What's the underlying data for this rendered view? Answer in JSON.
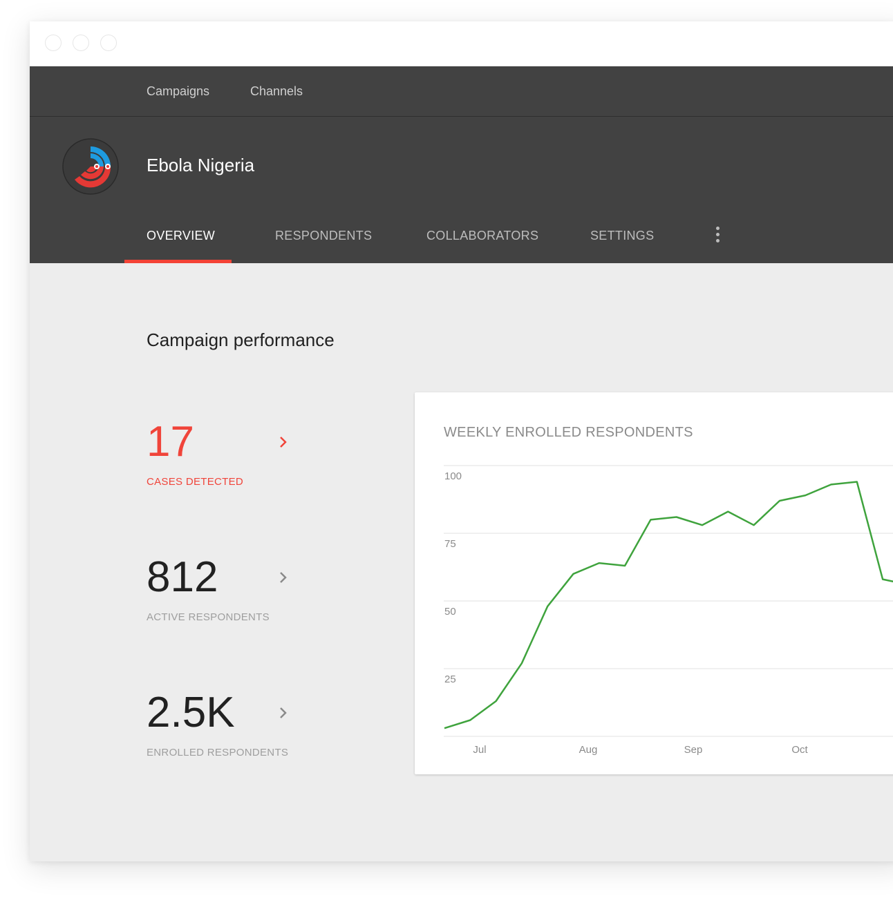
{
  "window": {
    "traffic_lights": [
      "close",
      "minimize",
      "maximize"
    ]
  },
  "topnav": {
    "items": [
      {
        "label": "Campaigns"
      },
      {
        "label": "Channels"
      }
    ]
  },
  "header": {
    "title": "Ebola Nigeria",
    "logo": "campaign-logo-icon",
    "tabs": [
      {
        "label": "OVERVIEW",
        "active": true
      },
      {
        "label": "RESPONDENTS",
        "active": false
      },
      {
        "label": "COLLABORATORS",
        "active": false
      },
      {
        "label": "SETTINGS",
        "active": false
      }
    ],
    "more_icon": "more-vert-icon",
    "accent_color": "#f44336",
    "background_color": "#424242"
  },
  "main": {
    "section_title": "Campaign performance",
    "stats": [
      {
        "value": "17",
        "label": "CASES DETECTED",
        "highlight": true
      },
      {
        "value": "812",
        "label": "ACTIVE RESPONDENTS",
        "highlight": false
      },
      {
        "value": "2.5K",
        "label": "ENROLLED RESPONDENTS",
        "highlight": false
      }
    ],
    "highlight_color": "#f0443a"
  },
  "chart_data": {
    "type": "line",
    "title": "WEEKLY ENROLLED RESPONDENTS",
    "xlabel": "",
    "ylabel": "",
    "ylim": [
      0,
      100
    ],
    "yticks": [
      100,
      75,
      50,
      25
    ],
    "xticks": [
      "Jul",
      "Aug",
      "Sep",
      "Oct"
    ],
    "grid": true,
    "line_color": "#3fa33d",
    "series": [
      {
        "values": [
          3,
          6,
          13,
          27,
          48,
          60,
          64,
          63,
          80,
          81,
          78,
          83,
          78,
          87,
          89,
          93,
          94,
          58,
          56
        ]
      }
    ]
  }
}
